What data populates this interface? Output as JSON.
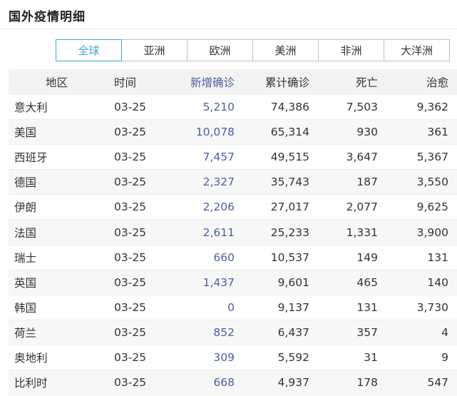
{
  "page_title": "国外疫情明细",
  "tabs": [
    {
      "label": "全球",
      "active": true
    },
    {
      "label": "亚洲",
      "active": false
    },
    {
      "label": "欧洲",
      "active": false
    },
    {
      "label": "美洲",
      "active": false
    },
    {
      "label": "非洲",
      "active": false
    },
    {
      "label": "大洋洲",
      "active": false
    }
  ],
  "colors": {
    "accent": "#3aa8d8",
    "new_cases_text": "#4a5fa0",
    "header_bg": "#f2f2f2",
    "alt_row_bg": "#f7f7f7"
  },
  "table": {
    "headers": {
      "region": "地区",
      "time": "时间",
      "new": "新增确诊",
      "total": "累计确诊",
      "death": "死亡",
      "cured": "治愈"
    },
    "rows": [
      {
        "region": "意大利",
        "time": "03-25",
        "new": "5,210",
        "total": "74,386",
        "death": "7,503",
        "cured": "9,362"
      },
      {
        "region": "美国",
        "time": "03-25",
        "new": "10,078",
        "total": "65,314",
        "death": "930",
        "cured": "361"
      },
      {
        "region": "西班牙",
        "time": "03-25",
        "new": "7,457",
        "total": "49,515",
        "death": "3,647",
        "cured": "5,367"
      },
      {
        "region": "德国",
        "time": "03-25",
        "new": "2,327",
        "total": "35,743",
        "death": "187",
        "cured": "3,550"
      },
      {
        "region": "伊朗",
        "time": "03-25",
        "new": "2,206",
        "total": "27,017",
        "death": "2,077",
        "cured": "9,625"
      },
      {
        "region": "法国",
        "time": "03-25",
        "new": "2,611",
        "total": "25,233",
        "death": "1,331",
        "cured": "3,900"
      },
      {
        "region": "瑞士",
        "time": "03-25",
        "new": "660",
        "total": "10,537",
        "death": "149",
        "cured": "131"
      },
      {
        "region": "英国",
        "time": "03-25",
        "new": "1,437",
        "total": "9,601",
        "death": "465",
        "cured": "140"
      },
      {
        "region": "韩国",
        "time": "03-25",
        "new": "0",
        "total": "9,137",
        "death": "131",
        "cured": "3,730"
      },
      {
        "region": "荷兰",
        "time": "03-25",
        "new": "852",
        "total": "6,437",
        "death": "357",
        "cured": "4"
      },
      {
        "region": "奥地利",
        "time": "03-25",
        "new": "309",
        "total": "5,592",
        "death": "31",
        "cured": "9"
      },
      {
        "region": "比利时",
        "time": "03-25",
        "new": "668",
        "total": "4,937",
        "death": "178",
        "cured": "547"
      }
    ]
  }
}
